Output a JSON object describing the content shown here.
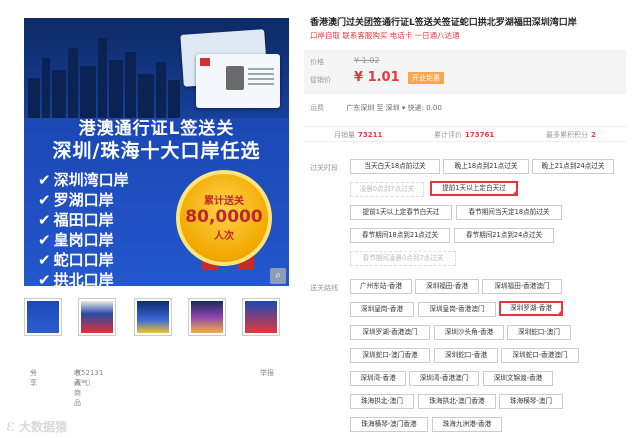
{
  "hero": {
    "line1": "港澳通行证L签送关",
    "line2": "深圳/珠海十大口岸任选",
    "ports": [
      "深圳湾口岸",
      "罗湖口岸",
      "福田口岸",
      "皇岗口岸",
      "蛇口口岸",
      "拱北口岸"
    ],
    "badge_top": "累计送关",
    "badge_num": "80,0000",
    "badge_bottom": "人次",
    "zoom_icon": "magnifier-icon"
  },
  "thumb_count": 5,
  "share": {
    "share_label": "分享",
    "fav_label": "收藏商品",
    "fav_count": "（52131人气）",
    "report_label": "举报"
  },
  "watermark": "大数据猿",
  "product": {
    "title": "香港澳门过关团签通行证L签送关签证蛇口拱北罗湖福田深圳湾口岸",
    "subtitle": "口岸自取 联系客服购买 电话卡 一日通八达通"
  },
  "price": {
    "price_label": "价格",
    "old_price": "¥ 1.02",
    "promo_label": "促销价",
    "new_price": "¥ 1.01",
    "promo_tag": "开业钜惠"
  },
  "shipping": {
    "label": "运费",
    "text": "广东深圳 至 深圳 ▾ 快递: 0.00"
  },
  "stats": {
    "monthly_label": "月销量",
    "monthly": "73211",
    "reviews_label": "累计评价",
    "reviews": "173761",
    "points_label": "最多累积积分",
    "points": "2"
  },
  "time_section": {
    "label": "过关时段",
    "options": [
      "当天白天18点前过关",
      "晚上18点到21点过关",
      "晚上21点到24点过关",
      "凌晨0点到7点过关",
      "提前1天以上定白天过",
      "提前1天以上定春节白天过",
      "春节期间当天定18点前过关",
      "春节期间18点到21点过关",
      "春节期间21点到24点过关",
      "春节期间凌晨0点到7点过关"
    ]
  },
  "route_section": {
    "label": "送关路线",
    "options": [
      "广州东站-香港",
      "深圳福田-香港",
      "深圳福田-香港澳门",
      "深圳皇岗-香港",
      "深圳皇岗-香港澳门",
      "深圳罗湖-香港",
      "深圳罗湖-香港澳门",
      "深圳沙头角-香港",
      "深圳蛇口-澳门",
      "深圳蛇口-澳门香港",
      "深圳蛇口-香港",
      "深圳蛇口-香港澳门",
      "深圳湾-香港",
      "深圳湾-香港澳门",
      "深圳文锦渡-香港",
      "珠海拱北-澳门",
      "珠海拱北-澳门香港",
      "珠海横琴-澳门",
      "珠海横琴-澳门香港",
      "珠海九洲港-香港"
    ]
  },
  "colors": {
    "accent": "#e4393c",
    "hero_blue": "#1c49b8",
    "badge_gold": "#f2a800"
  }
}
